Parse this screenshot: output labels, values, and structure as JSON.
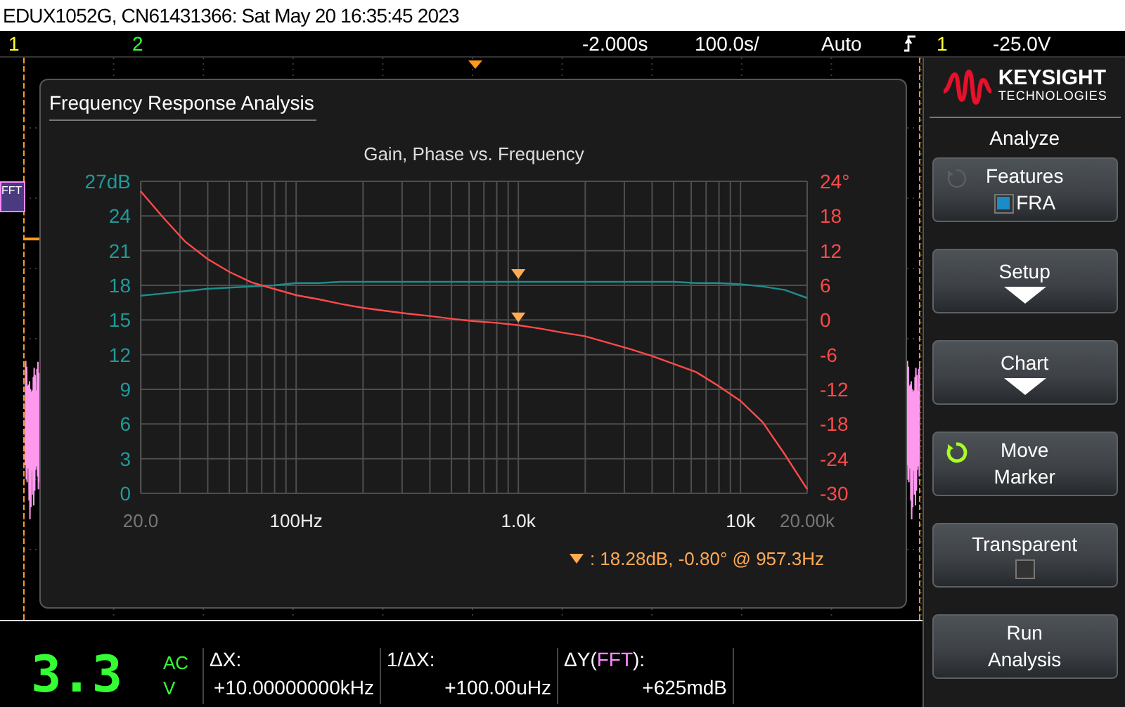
{
  "title_bar": {
    "text": "EDUX1052G, CN61431366: Sat May 20 16:35:45 2023"
  },
  "status_bar": {
    "channels": [
      {
        "label": "1",
        "color": "#ffff33"
      },
      {
        "label": "2",
        "color": "#33ff33"
      }
    ],
    "time_offset": "-2.000s",
    "time_scale": "100.0s/",
    "mode": "Auto",
    "trigger": {
      "source": "1",
      "color": "#ffff33",
      "level": "-25.0V"
    }
  },
  "scope": {
    "channel_label": "FFT"
  },
  "dialog": {
    "title": "Frequency Response Analysis",
    "chart_data": {
      "type": "line",
      "title": "Gain, Phase vs. Frequency",
      "categories": [
        "20.0",
        null,
        null,
        null,
        null,
        null,
        null,
        "100Hz",
        null,
        null,
        null,
        null,
        null,
        null,
        null,
        null,
        null,
        "1.0k",
        null,
        null,
        null,
        null,
        null,
        null,
        null,
        null,
        null,
        "10k",
        null,
        null,
        "20.00k"
      ],
      "ylim": [
        0,
        27
      ],
      "yticks": [
        {
          "value": 0,
          "label": "0"
        },
        {
          "value": 3,
          "label": "3"
        },
        {
          "value": 6,
          "label": "6"
        },
        {
          "value": 9,
          "label": "9"
        },
        {
          "value": 12,
          "label": "12"
        },
        {
          "value": 15,
          "label": "15"
        },
        {
          "value": 18,
          "label": "18"
        },
        {
          "value": 21,
          "label": "21"
        },
        {
          "value": 24,
          "label": "24"
        },
        {
          "value": 27,
          "label": "27dB"
        }
      ],
      "y2lim": [
        -30,
        24
      ],
      "y2ticks": [
        {
          "value": -30,
          "label": "-30"
        },
        {
          "value": -24,
          "label": "-24"
        },
        {
          "value": -18,
          "label": "-18"
        },
        {
          "value": -12,
          "label": "-12"
        },
        {
          "value": -6,
          "label": "-6"
        },
        {
          "value": 0,
          "label": "0"
        },
        {
          "value": 6,
          "label": "6"
        },
        {
          "value": 12,
          "label": "12"
        },
        {
          "value": 18,
          "label": "18"
        },
        {
          "value": 24,
          "label": "24°"
        }
      ],
      "series": [
        {
          "color": "#1f8c8c",
          "values": [
            17.1,
            17.3,
            17.5,
            17.7,
            17.8,
            17.9,
            18.0,
            18.2,
            18.2,
            18.3,
            18.3,
            18.3,
            18.3,
            18.3,
            18.3,
            18.3,
            18.3,
            18.3,
            18.3,
            18.3,
            18.3,
            18.3,
            18.3,
            18.3,
            18.3,
            18.2,
            18.2,
            18.1,
            17.9,
            17.6,
            16.9
          ]
        },
        {
          "color": "#ff4a4a",
          "axis": "y2",
          "values": [
            22.3,
            17.8,
            13.6,
            10.6,
            8.3,
            6.5,
            5.4,
            4.3,
            3.6,
            2.8,
            2.1,
            1.6,
            1.1,
            0.7,
            0.2,
            -0.2,
            -0.5,
            -0.9,
            -1.5,
            -2.2,
            -2.8,
            -3.9,
            -5.0,
            -6.2,
            -7.6,
            -9.0,
            -11.4,
            -14.0,
            -17.7,
            -23.3,
            -29.3
          ]
        }
      ],
      "grid": true,
      "annotations": [
        {
          "x": "1.0k"
        }
      ]
    },
    "readout": ":  18.28dB, -0.80° @ 957.3Hz"
  },
  "bottom_bar": {
    "meter": {
      "reading": "3.3",
      "coupling": "AC",
      "unit": "V"
    },
    "measurements": [
      {
        "label": [
          {
            "text": "ΔX:"
          }
        ],
        "value": "+10.00000000kHz"
      },
      {
        "label": [
          {
            "text": "1/ΔX:"
          }
        ],
        "value": "+100.00uHz"
      },
      {
        "label": [
          {
            "text": "ΔY("
          },
          {
            "text": "FFT",
            "color": "#ff88ff"
          },
          {
            "text": "):"
          }
        ],
        "value": "+625mdB"
      }
    ]
  },
  "side_panel": {
    "brand": {
      "name": "KEYSIGHT",
      "tagline": "TECHNOLOGIES"
    },
    "heading": "Analyze",
    "softkeys": [
      {
        "kind": "checkbox",
        "lines": [
          "Features"
        ],
        "knob_active": false,
        "checkbox": {
          "label": "FRA",
          "checked": true
        }
      },
      {
        "kind": "submenu",
        "lines": [
          "Setup"
        ]
      },
      {
        "kind": "submenu",
        "lines": [
          "Chart"
        ]
      },
      {
        "kind": "plain",
        "lines": [
          "Move",
          "Marker"
        ],
        "knob_active": true
      },
      {
        "kind": "checkbox",
        "lines": [
          "Transparent"
        ],
        "checkbox": {
          "checked": false
        }
      },
      {
        "kind": "plain",
        "lines": [
          "Run",
          "Analysis"
        ]
      }
    ]
  }
}
